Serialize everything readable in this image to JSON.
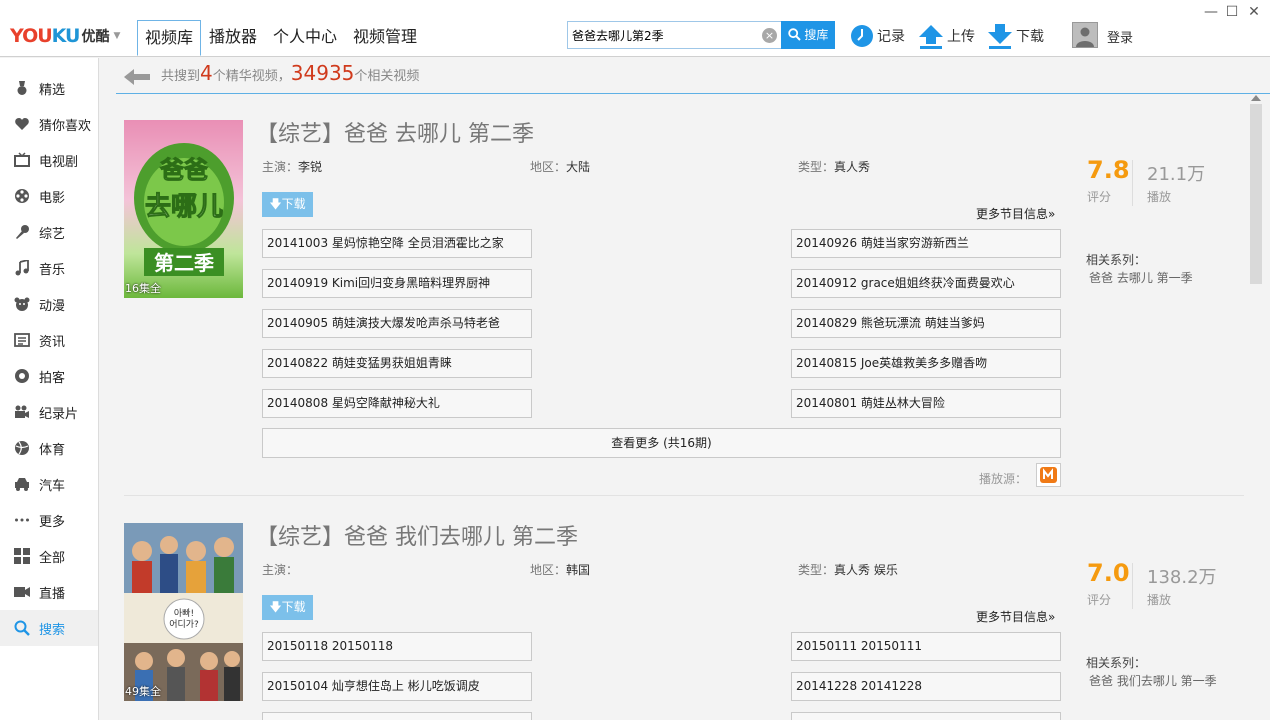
{
  "header": {
    "logo": {
      "you": "YOU",
      "ku": "KU",
      "cn": "优酷"
    },
    "tabs": [
      {
        "label": "视频库",
        "active": true
      },
      {
        "label": "播放器"
      },
      {
        "label": "个人中心"
      },
      {
        "label": "视频管理"
      }
    ],
    "search": {
      "value": "爸爸去哪儿第2季",
      "button_label": "搜库"
    },
    "tools": {
      "history": "记录",
      "upload": "上传",
      "download": "下载"
    },
    "login": "登录"
  },
  "sidebar": {
    "items": [
      {
        "label": "精选",
        "icon": "medal-icon"
      },
      {
        "label": "猜你喜欢",
        "icon": "heart-icon"
      },
      {
        "label": "电视剧",
        "icon": "tv-icon"
      },
      {
        "label": "电影",
        "icon": "film-reel-icon"
      },
      {
        "label": "综艺",
        "icon": "microphone-icon"
      },
      {
        "label": "音乐",
        "icon": "music-note-icon"
      },
      {
        "label": "动漫",
        "icon": "cartoon-bear-icon"
      },
      {
        "label": "资讯",
        "icon": "news-icon"
      },
      {
        "label": "拍客",
        "icon": "camera-icon"
      },
      {
        "label": "纪录片",
        "icon": "video-camera-icon"
      },
      {
        "label": "体育",
        "icon": "ball-icon"
      },
      {
        "label": "汽车",
        "icon": "car-icon"
      },
      {
        "label": "更多",
        "icon": "more-dots-icon"
      },
      {
        "label": "全部",
        "icon": "grid-icon"
      },
      {
        "label": "直播",
        "icon": "live-icon"
      },
      {
        "label": "搜索",
        "icon": "search-icon",
        "active": true
      }
    ]
  },
  "summary": {
    "prefix": "共搜到",
    "featured_count": "4",
    "middle": "个精华视频，",
    "total_count": "34935",
    "suffix": "个相关视频"
  },
  "results": [
    {
      "title": "【综艺】爸爸 去哪儿 第二季",
      "episodes_badge": "16集全",
      "starring_label": "主演：",
      "starring": "李锐",
      "region_label": "地区：",
      "region": "大陆",
      "genre_label": "类型：",
      "genre": "真人秀",
      "download_label": "下载",
      "more_info": "更多节目信息»",
      "episodes_left": [
        "20141003 星妈惊艳空降 全员泪洒霍比之家",
        "20140919 Kimi回归变身黑暗料理界厨神",
        "20140905 萌娃演技大爆发呛声杀马特老爸",
        "20140822 萌娃变猛男获姐姐青睐",
        "20140808 星妈空降献神秘大礼"
      ],
      "episodes_right": [
        "20140926 萌娃当家穷游新西兰",
        "20140912 grace姐姐终获冷面费曼欢心",
        "20140829 熊爸玩漂流 萌娃当爹妈",
        "20140815 Joe英雄救美多多赠香吻",
        "20140801 萌娃丛林大冒险"
      ],
      "see_more": "查看更多 (共16期)",
      "source_label": "播放源：",
      "score": "7.8",
      "score_label": "评分",
      "plays": "21.1万",
      "plays_label": "播放",
      "series_label": "相关系列：",
      "series": "爸爸 去哪儿 第一季"
    },
    {
      "title": "【综艺】爸爸 我们去哪儿 第二季",
      "episodes_badge": "49集全",
      "starring_label": "主演：",
      "starring": "",
      "region_label": "地区：",
      "region": "韩国",
      "genre_label": "类型：",
      "genre": "真人秀 娱乐",
      "download_label": "下载",
      "more_info": "更多节目信息»",
      "episodes_left": [
        "20150118 20150118",
        "20150104 灿亨想住岛上 彬儿吃饭调皮"
      ],
      "episodes_right": [
        "20150111 20150111",
        "20141228 20141228"
      ],
      "score": "7.0",
      "score_label": "评分",
      "plays": "138.2万",
      "plays_label": "播放",
      "series_label": "相关系列：",
      "series": "爸爸 我们去哪儿 第一季"
    }
  ],
  "colors": {
    "accent": "#1f95e6",
    "score": "#f59a0f",
    "count": "#d03a1c"
  }
}
